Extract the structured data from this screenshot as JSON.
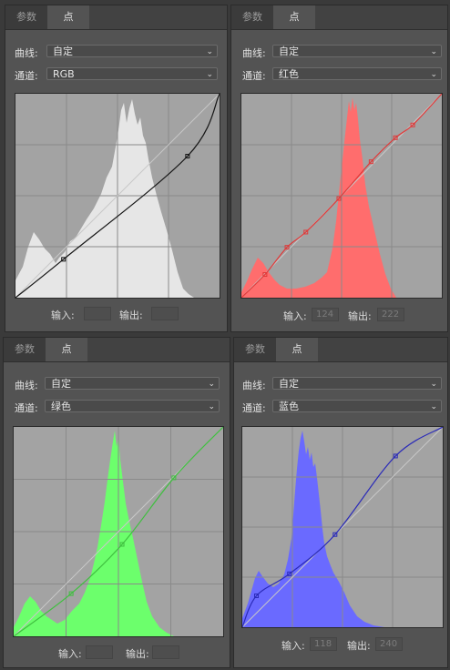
{
  "panels": [
    {
      "id": "rgb",
      "tabs": {
        "properties": "参数",
        "points": "点"
      },
      "preset_label": "曲线:",
      "preset_value": "自定",
      "channel_label": "通道:",
      "channel_value": "RGB",
      "input_label": "输入:",
      "input_value": "",
      "output_label": "输出:",
      "output_value": "",
      "hist_color": "#e6e6e6",
      "curve_color": "#151515",
      "curve_points": [
        [
          0,
          0
        ],
        [
          60,
          48
        ],
        [
          215,
          177
        ],
        [
          255,
          255
        ]
      ]
    },
    {
      "id": "red",
      "tabs": {
        "properties": "参数",
        "points": "点"
      },
      "preset_label": "曲线:",
      "preset_value": "自定",
      "channel_label": "通道:",
      "channel_value": "红色",
      "input_label": "输入:",
      "input_value": "124",
      "output_label": "输出:",
      "output_value": "222",
      "hist_color": "#ff6d6d",
      "curve_color": "#e03a3a",
      "curve_points": [
        [
          0,
          0
        ],
        [
          30,
          29
        ],
        [
          58,
          63
        ],
        [
          82,
          82
        ],
        [
          124,
          124
        ],
        [
          165,
          170
        ],
        [
          196,
          200
        ],
        [
          218,
          216
        ],
        [
          255,
          255
        ]
      ]
    },
    {
      "id": "green",
      "tabs": {
        "properties": "参数",
        "points": "点"
      },
      "preset_label": "曲线:",
      "preset_value": "自定",
      "channel_label": "通道:",
      "channel_value": "绿色",
      "input_label": "输入:",
      "input_value": "",
      "output_label": "输出:",
      "output_value": "",
      "hist_color": "#6cff6c",
      "curve_color": "#3fbf3f",
      "curve_points": [
        [
          0,
          0
        ],
        [
          70,
          52
        ],
        [
          132,
          112
        ],
        [
          195,
          193
        ],
        [
          255,
          255
        ]
      ]
    },
    {
      "id": "blue",
      "tabs": {
        "properties": "参数",
        "points": "点"
      },
      "preset_label": "曲线:",
      "preset_value": "自定",
      "channel_label": "通道:",
      "channel_value": "蓝色",
      "input_label": "输入:",
      "input_value": "118",
      "output_label": "输出:",
      "output_value": "240",
      "hist_color": "#6a6aff",
      "curve_color": "#2b2bb8",
      "curve_points": [
        [
          0,
          0
        ],
        [
          18,
          40
        ],
        [
          60,
          68
        ],
        [
          118,
          118
        ],
        [
          195,
          218
        ],
        [
          255,
          255
        ]
      ]
    }
  ]
}
